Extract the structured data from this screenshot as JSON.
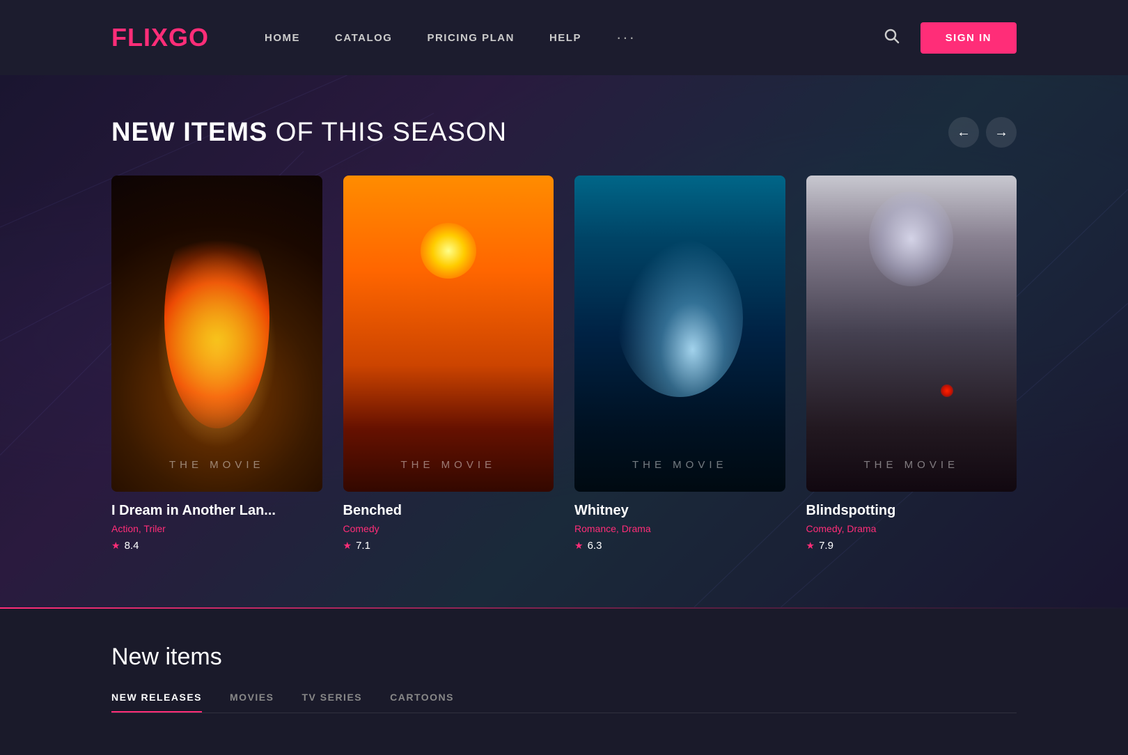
{
  "logo": {
    "prefix": "FLIX",
    "suffix": "GO"
  },
  "nav": {
    "items": [
      {
        "id": "home",
        "label": "HOME"
      },
      {
        "id": "catalog",
        "label": "CATALOG"
      },
      {
        "id": "pricing",
        "label": "PRICING PLAN"
      },
      {
        "id": "help",
        "label": "HELP"
      }
    ],
    "more_label": "···"
  },
  "header": {
    "signin_label": "SIGN IN"
  },
  "hero": {
    "section_title_bold": "NEW ITEMS",
    "section_title_rest": " OF THIS SEASON"
  },
  "movies": [
    {
      "id": "movie-1",
      "title": "I Dream in Another Lan...",
      "genres": "Action, Triler",
      "rating": "8.4",
      "poster_label": "THE MOVIE",
      "poster_class": "poster-1"
    },
    {
      "id": "movie-2",
      "title": "Benched",
      "genres": "Comedy",
      "rating": "7.1",
      "poster_label": "THE MOVIE",
      "poster_class": "poster-2"
    },
    {
      "id": "movie-3",
      "title": "Whitney",
      "genres": "Romance, Drama",
      "rating": "6.3",
      "poster_label": "THE MOVIE",
      "poster_class": "poster-3"
    },
    {
      "id": "movie-4",
      "title": "Blindspotting",
      "genres": "Comedy, Drama",
      "rating": "7.9",
      "poster_label": "THE MOVIE",
      "poster_class": "poster-4"
    }
  ],
  "new_items": {
    "title": "New items",
    "tabs": [
      {
        "id": "new-releases",
        "label": "NEW RELEASES",
        "active": true
      },
      {
        "id": "movies",
        "label": "MOVIES",
        "active": false
      },
      {
        "id": "tv-series",
        "label": "TV SERIES",
        "active": false
      },
      {
        "id": "cartoons",
        "label": "CARTOONS",
        "active": false
      }
    ]
  },
  "icons": {
    "search": "🔍",
    "arrow_left": "←",
    "arrow_right": "→",
    "star": "★"
  }
}
